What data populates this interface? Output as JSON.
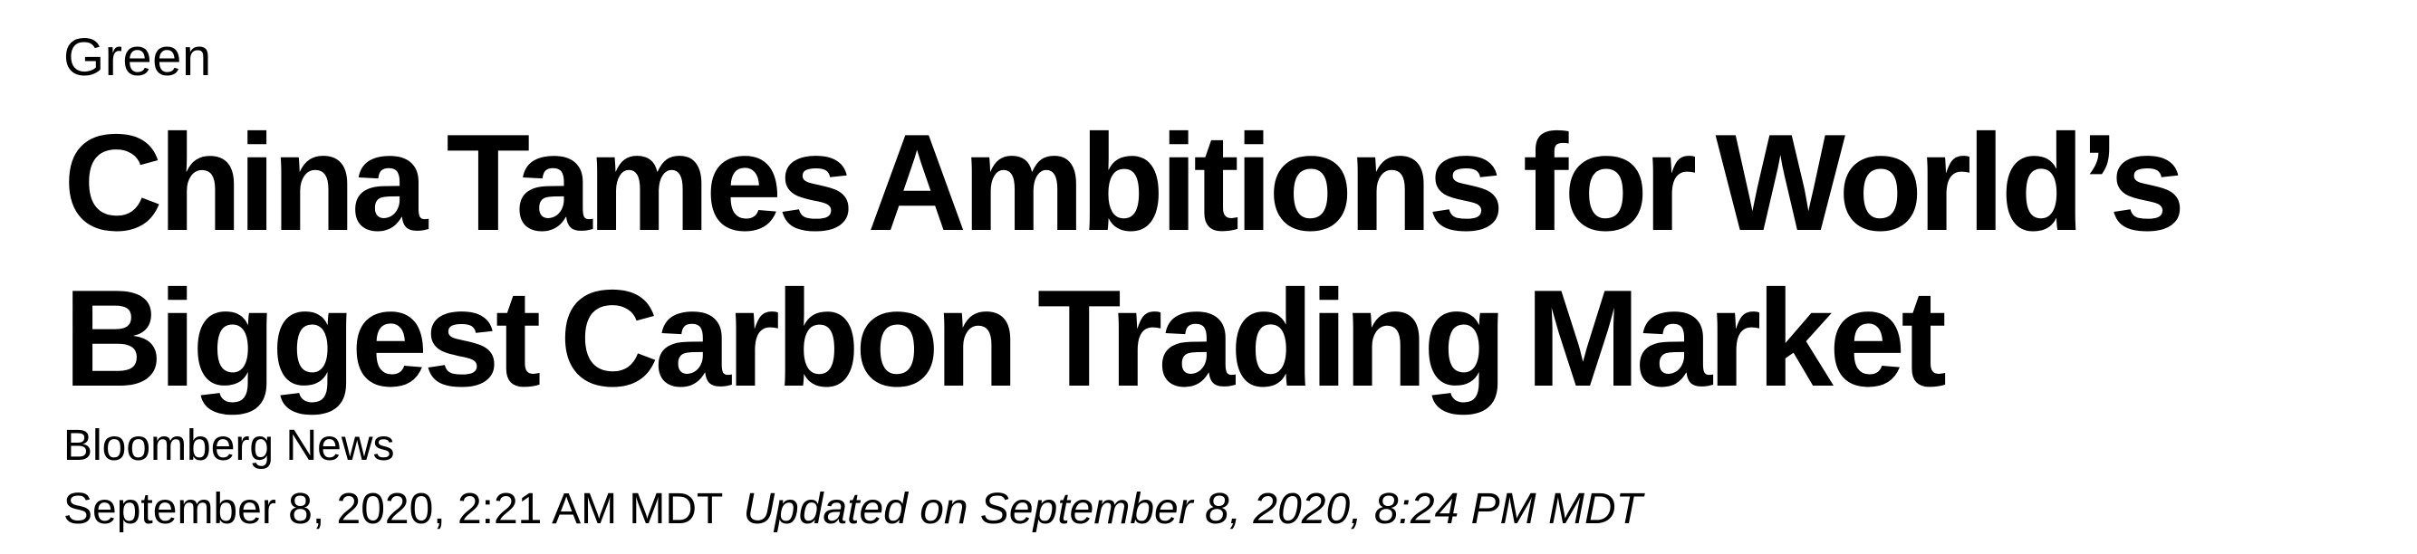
{
  "article": {
    "section": "Green",
    "headline_line1": "China Tames Ambitions for World’s",
    "headline_line2": "Biggest Carbon Trading Market",
    "author": "Bloomberg News",
    "published": "September 8, 2020, 2:21 AM MDT",
    "updated": "Updated on September 8, 2020, 8:24 PM MDT"
  }
}
